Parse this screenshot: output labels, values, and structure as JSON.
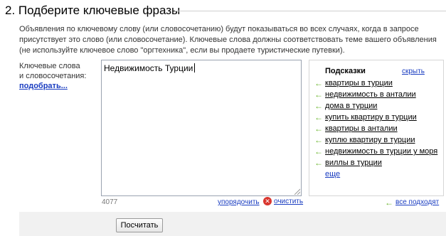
{
  "section": {
    "title": "2. Подберите ключевые фразы"
  },
  "description": "Объявления по ключевому слову (или словосочетанию) будут показываться во всех случаях, когда в запросе присутствует это слово (или словосочетание). Ключевые слова должны соответствовать теме вашего объявления (не используйте ключевое слово \"оргтехника\", если вы продаете туристические путевки).",
  "keywords": {
    "label_line1": "Ключевые слова",
    "label_line2": "и словосочетания:",
    "pick_link": "подобрать...",
    "value": "Недвижимость Турции",
    "counter": "4077",
    "sort_link": "упорядочить",
    "clear_link": "очистить"
  },
  "hints": {
    "title": "Подсказки",
    "hide_link": "скрыть",
    "items": [
      "квартиры в турции",
      "недвижимость в анталии",
      "дома в турции",
      "купить квартиру в турции",
      "квартиры в анталии",
      "куплю квартиру в турции",
      "недвижимость в турции у моря",
      "виллы в турции"
    ],
    "more_link": "еще",
    "all_fit_link": "все подходят"
  },
  "footer": {
    "calc_button": "Посчитать"
  },
  "colors": {
    "link": "#1a3dc1",
    "arrow": "#6ab52b",
    "clear_icon": "#d9362e",
    "bottom_bar": "#f1f1f1"
  },
  "icons": {
    "hint_arrow": "left-arrow-icon",
    "clear": "clear-x-icon",
    "resize": "resize-grip-icon"
  }
}
